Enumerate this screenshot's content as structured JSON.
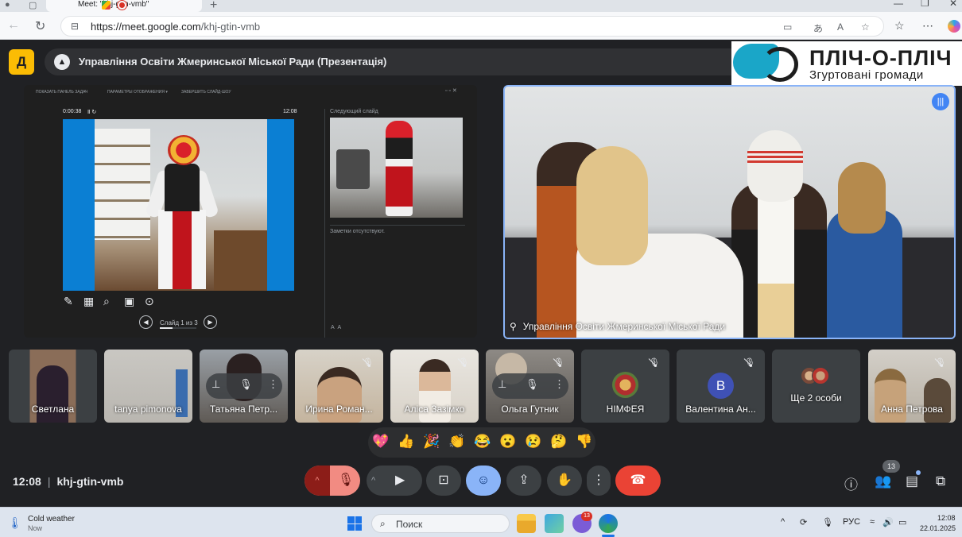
{
  "browser": {
    "tab_title": "Meet: \"khj-gtin-vmb\"",
    "url_host": "https://meet.google.com",
    "url_path": "/khj-gtin-vmb"
  },
  "meet": {
    "presentation_title": "Управління Освіти Жмеринської Міської Ради (Презентація)",
    "brand_name": "ПЛІЧ-О-ПЛІЧ",
    "brand_slogan": "Згуртовані громади",
    "presenter": {
      "menu": [
        "ПОКАЗАТЬ ПАНЕЛЬ ЗАДАЧ",
        "ПАРАМЕТРЫ ОТОБРАЖЕНИЯ ▾",
        "ЗАВЕРШИТЬ СЛАЙД-ШОУ"
      ],
      "elapsed": "0:00:38",
      "clock": "12:08",
      "next_slide_label": "Следующий слайд",
      "notes": "Заметки отсутствуют.",
      "slide_counter": "Слайд 1 из 3"
    },
    "main_video_label": "Управління Освіти Жмеринської Міської Ради",
    "participants": [
      {
        "name": "Светлана"
      },
      {
        "name": "tanya pimonova"
      },
      {
        "name": "Татьяна Петр..."
      },
      {
        "name": "Ирина Роман..."
      },
      {
        "name": "Аліса Зазімко"
      },
      {
        "name": "Ольга Гутник"
      },
      {
        "name": "НІМФЕЯ"
      },
      {
        "name": "Валентина Ан...",
        "initial": "В"
      },
      {
        "name": "Ще 2 особи"
      },
      {
        "name": "Анна Петрова"
      }
    ],
    "reactions": [
      "💖",
      "👍",
      "🎉",
      "👏",
      "😂",
      "😮",
      "😢",
      "🤔",
      "👎"
    ],
    "bottom": {
      "time": "12:08",
      "meeting_code": "khj-gtin-vmb",
      "people_count": "13"
    }
  },
  "taskbar": {
    "weather_title": "Cold weather",
    "weather_sub": "Now",
    "search_placeholder": "Поиск",
    "badge": "13",
    "lang": "РУС",
    "time": "12:08",
    "date": "22.01.2025"
  }
}
